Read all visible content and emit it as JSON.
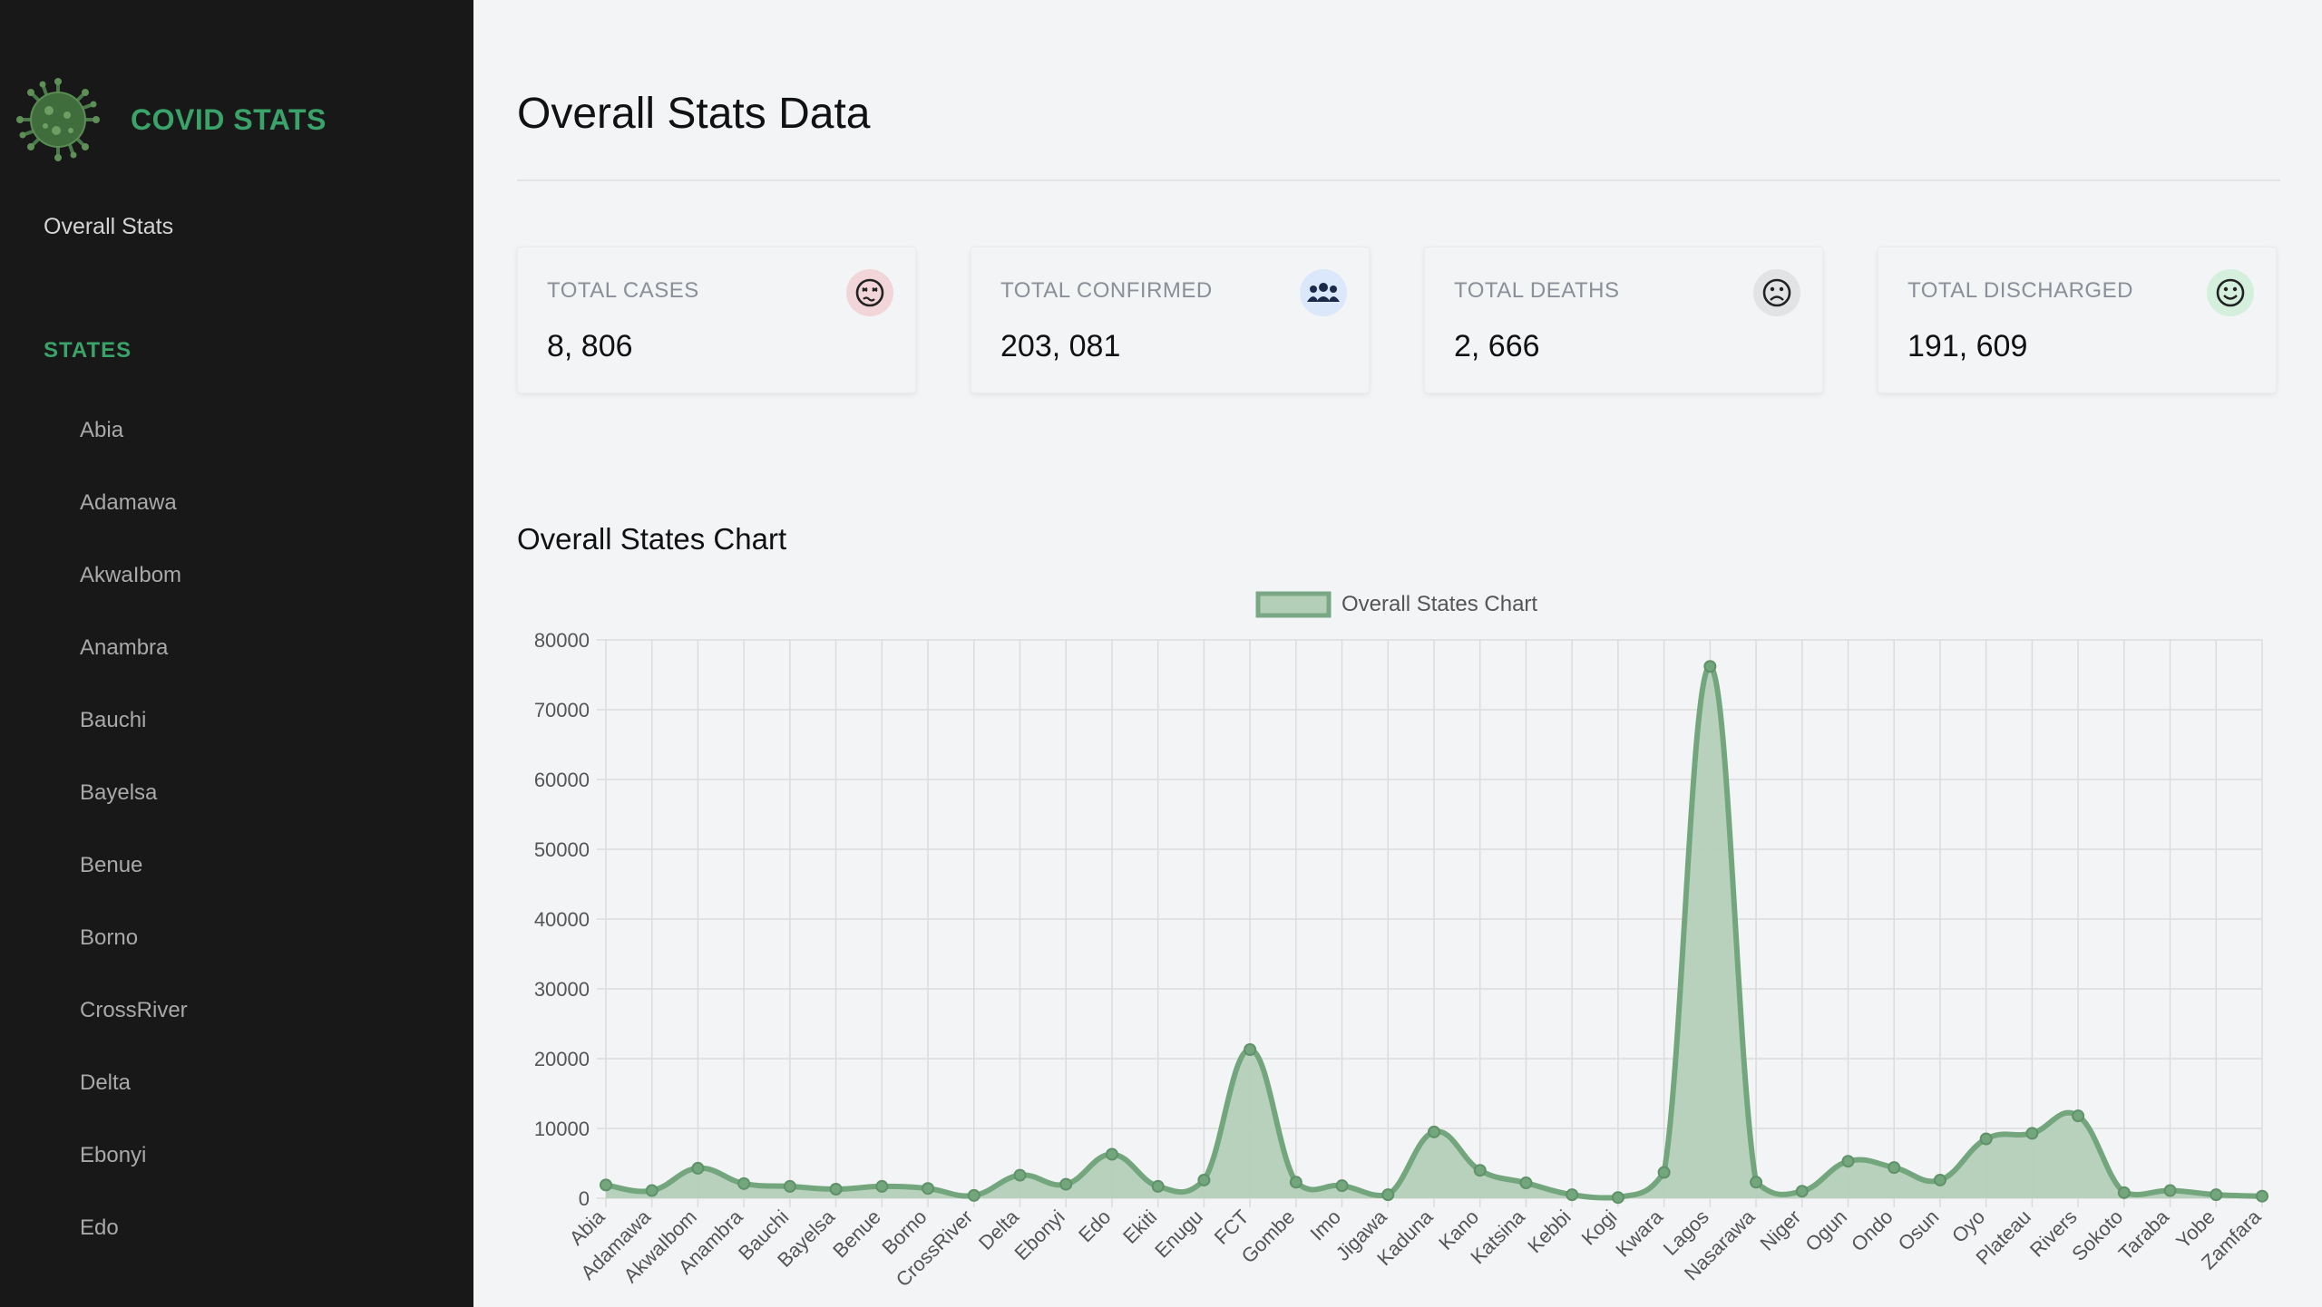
{
  "sidebar": {
    "brand": "COVID STATS",
    "overall_link": "Overall Stats",
    "states_heading": "STATES",
    "states": [
      "Abia",
      "Adamawa",
      "AkwaIbom",
      "Anambra",
      "Bauchi",
      "Bayelsa",
      "Benue",
      "Borno",
      "CrossRiver",
      "Delta",
      "Ebonyi",
      "Edo"
    ]
  },
  "main": {
    "title": "Overall Stats Data",
    "cards": [
      {
        "label": "TOTAL CASES",
        "value": "8, 806",
        "icon": "sick-face-icon",
        "icon_bg": "#f1d5d8"
      },
      {
        "label": "TOTAL CONFIRMED",
        "value": "203, 081",
        "icon": "group-icon",
        "icon_bg": "#dbe8fb"
      },
      {
        "label": "TOTAL DEATHS",
        "value": "2, 666",
        "icon": "sad-face-icon",
        "icon_bg": "#e2e3e5"
      },
      {
        "label": "TOTAL DISCHARGED",
        "value": "191, 609",
        "icon": "smile-face-icon",
        "icon_bg": "#d4f0dc"
      }
    ],
    "chart_title": "Overall States Chart"
  },
  "colors": {
    "accent": "#3aa36a",
    "series_line": "#73a67d",
    "series_fill": "#b3cfb8"
  },
  "chart_data": {
    "type": "area",
    "legend": "Overall States Chart",
    "legend_position": "top",
    "grid": true,
    "ylim": [
      0,
      80000
    ],
    "y_ticks": [
      0,
      10000,
      20000,
      30000,
      40000,
      50000,
      60000,
      70000,
      80000
    ],
    "categories": [
      "Abia",
      "Adamawa",
      "AkwaIbom",
      "Anambra",
      "Bauchi",
      "Bayelsa",
      "Benue",
      "Borno",
      "CrossRiver",
      "Delta",
      "Ebonyi",
      "Edo",
      "Ekiti",
      "Enugu",
      "FCT",
      "Gombe",
      "Imo",
      "Jigawa",
      "Kaduna",
      "Kano",
      "Katsina",
      "Kebbi",
      "Kogi",
      "Kwara",
      "Lagos",
      "Nasarawa",
      "Niger",
      "Ogun",
      "Ondo",
      "Osun",
      "Oyo",
      "Plateau",
      "Rivers",
      "Sokoto",
      "Taraba",
      "Yobe",
      "Zamfara"
    ],
    "series": [
      {
        "name": "Overall States Chart",
        "values": [
          1900,
          1100,
          4300,
          2100,
          1700,
          1300,
          1700,
          1400,
          400,
          3300,
          2000,
          6300,
          1700,
          2600,
          21300,
          2300,
          1800,
          500,
          9500,
          4000,
          2200,
          500,
          100,
          3700,
          76200,
          2300,
          1000,
          5300,
          4400,
          2600,
          8500,
          9300,
          11800,
          800,
          1100,
          500,
          300
        ]
      }
    ]
  }
}
